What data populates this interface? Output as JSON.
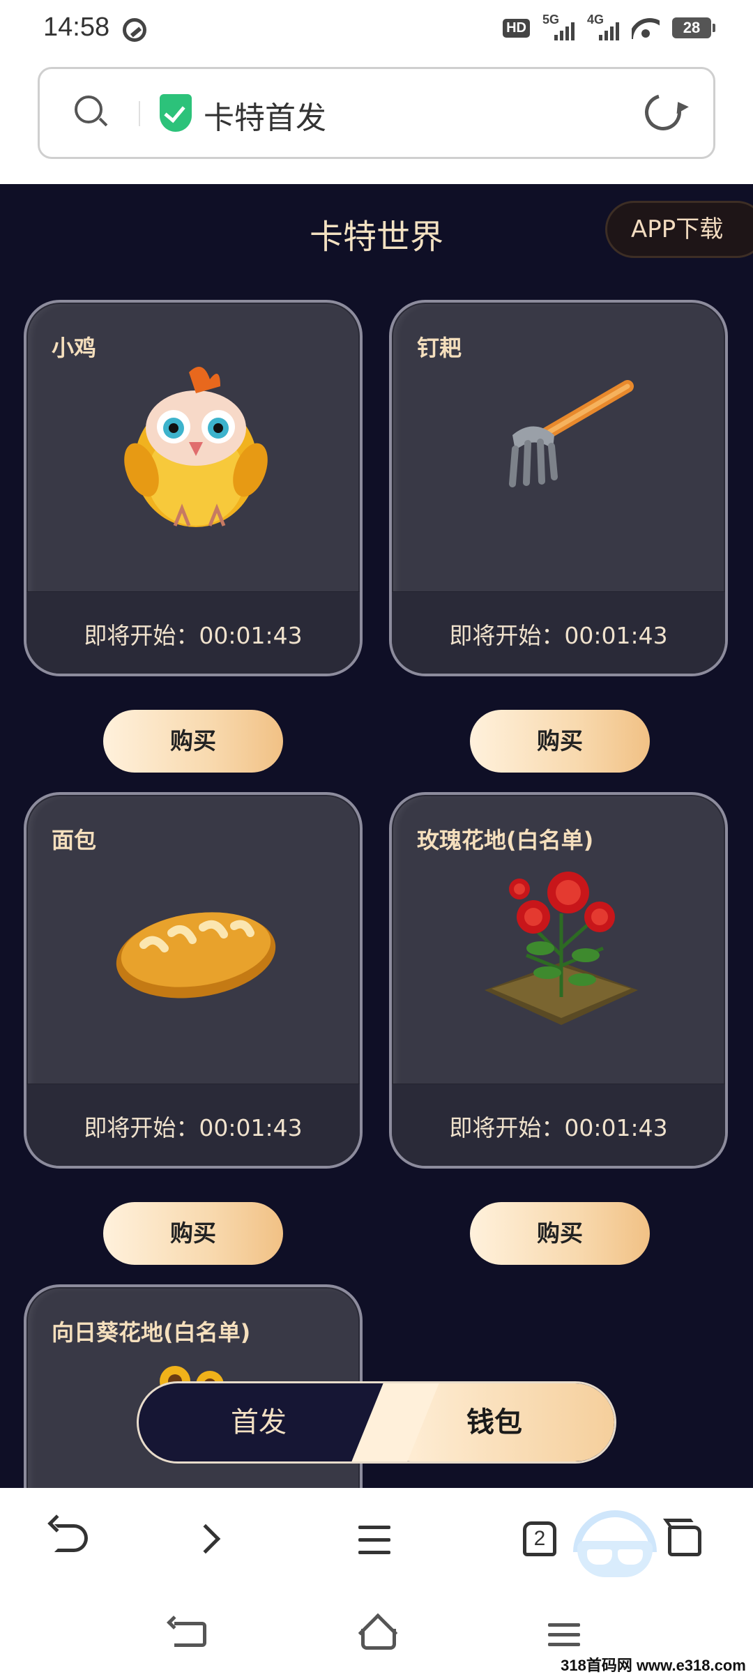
{
  "status_bar": {
    "time": "14:58",
    "network_1": "5G",
    "network_2": "4G",
    "battery": "28",
    "icons": [
      "sync-icon",
      "hd-icon",
      "signal-icon",
      "wifi-icon",
      "battery-icon"
    ]
  },
  "address_bar": {
    "title": "卡特首发",
    "icons": [
      "search-icon",
      "shield-check-icon",
      "reload-icon"
    ],
    "accent_color": "#2cc27a"
  },
  "page": {
    "title": "卡特世界",
    "app_download": "APP下载",
    "background_color": "#0f0f26"
  },
  "items": [
    {
      "name": "小鸡",
      "countdown": "即将开始：00:01:43",
      "buy_label": "购买",
      "icon": "chick-icon"
    },
    {
      "name": "钉耙",
      "countdown": "即将开始：00:01:43",
      "buy_label": "购买",
      "icon": "rake-icon"
    },
    {
      "name": "面包",
      "countdown": "即将开始：00:01:43",
      "buy_label": "购买",
      "icon": "bread-icon"
    },
    {
      "name": "玫瑰花地(白名单)",
      "countdown": "即将开始：00:01:43",
      "buy_label": "购买",
      "icon": "rose-field-icon"
    },
    {
      "name": "向日葵花地(白名单)",
      "icon": "sunflower-field-icon"
    }
  ],
  "bottom_tabs": {
    "left": "首发",
    "right": "钱包",
    "active": "right"
  },
  "toolbar": {
    "tab_count": "2",
    "icons": [
      "back-icon",
      "forward-icon",
      "menu-icon",
      "tabs-icon",
      "incognito-mask-icon",
      "home-icon"
    ]
  },
  "watermark": "318首码网 www.e318.com"
}
